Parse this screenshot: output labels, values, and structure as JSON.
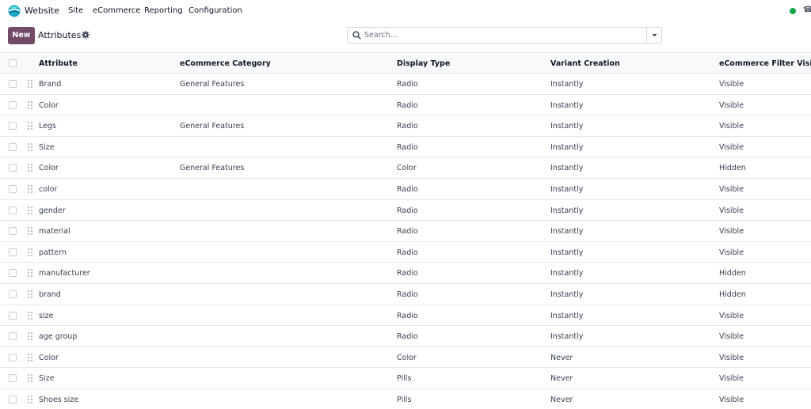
{
  "topbar": {
    "app_name": "Website",
    "menu": [
      "Site",
      "eCommerce",
      "Reporting",
      "Configuration"
    ],
    "icons": {
      "logo": "odoo-website-logo",
      "status": "online-status-dot",
      "phone": "phone-icon"
    },
    "status_color": "#16a34a"
  },
  "control": {
    "new_label": "New",
    "title": "Attributes",
    "search_placeholder": "Search..."
  },
  "colors": {
    "primary": "#714b67",
    "header_bg": "#f8f9fa",
    "border": "#e5e7eb"
  },
  "table": {
    "columns": [
      "Attribute",
      "eCommerce Category",
      "Display Type",
      "Variant Creation",
      "eCommerce Filter Visibility"
    ],
    "rows": [
      [
        "Brand",
        "General Features",
        "Radio",
        "Instantly",
        "Visible"
      ],
      [
        "Color",
        "",
        "Radio",
        "Instantly",
        "Visible"
      ],
      [
        "Legs",
        "General Features",
        "Radio",
        "Instantly",
        "Visible"
      ],
      [
        "Size",
        "",
        "Radio",
        "Instantly",
        "Visible"
      ],
      [
        "Color",
        "General Features",
        "Color",
        "Instantly",
        "Hidden"
      ],
      [
        "color",
        "",
        "Radio",
        "Instantly",
        "Visible"
      ],
      [
        "gender",
        "",
        "Radio",
        "Instantly",
        "Visible"
      ],
      [
        "material",
        "",
        "Radio",
        "Instantly",
        "Visible"
      ],
      [
        "pattern",
        "",
        "Radio",
        "Instantly",
        "Visible"
      ],
      [
        "manufacturer",
        "",
        "Radio",
        "Instantly",
        "Hidden"
      ],
      [
        "brand",
        "",
        "Radio",
        "Instantly",
        "Hidden"
      ],
      [
        "size",
        "",
        "Radio",
        "Instantly",
        "Visible"
      ],
      [
        "age group",
        "",
        "Radio",
        "Instantly",
        "Visible"
      ],
      [
        "Color",
        "",
        "Color",
        "Never",
        "Visible"
      ],
      [
        "Size",
        "",
        "Pills",
        "Never",
        "Visible"
      ],
      [
        "Shoes size",
        "",
        "Pills",
        "Never",
        "Visible"
      ]
    ]
  }
}
